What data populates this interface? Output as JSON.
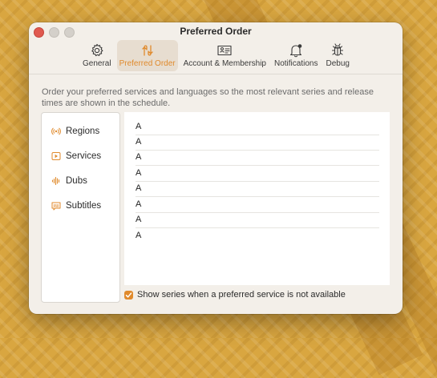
{
  "window": {
    "title": "Preferred Order"
  },
  "toolbar": {
    "items": [
      {
        "label": "General",
        "icon": "gear-icon",
        "active": false
      },
      {
        "label": "Preferred Order",
        "icon": "reorder-arrows-icon",
        "active": true
      },
      {
        "label": "Account & Membership",
        "icon": "id-card-icon",
        "active": false
      },
      {
        "label": "Notifications",
        "icon": "bell-icon",
        "active": false
      },
      {
        "label": "Debug",
        "icon": "bug-icon",
        "active": false
      }
    ]
  },
  "description": "Order your preferred services and languages so the most relevant series and release times are shown in the schedule.",
  "sidebar": {
    "items": [
      {
        "label": "Regions",
        "icon": "broadcast-icon"
      },
      {
        "label": "Services",
        "icon": "play-icon"
      },
      {
        "label": "Dubs",
        "icon": "waveform-icon"
      },
      {
        "label": "Subtitles",
        "icon": "captions-icon"
      }
    ]
  },
  "list": {
    "rows": [
      "A",
      "A",
      "A",
      "A",
      "A",
      "A",
      "A",
      "A"
    ]
  },
  "options": {
    "show_unavailable_label": "Show series when a preferred service is not available",
    "show_unavailable_checked": true
  },
  "colors": {
    "accent": "#e08a2c",
    "window_bg": "#f3efe9",
    "desktop": "#d9a640"
  }
}
